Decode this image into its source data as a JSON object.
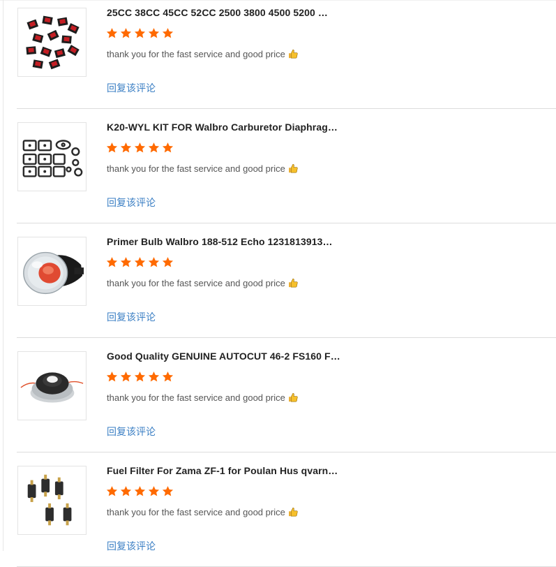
{
  "colors": {
    "star": "#ff6a00",
    "link": "#3b7fc4",
    "title": "#222222",
    "review": "#555555"
  },
  "reviews": [
    {
      "thumb_icon": "rocker-switches-image",
      "title": "25CC 38CC 45CC 52CC 2500 3800 4500 5200 …",
      "rating": 5,
      "text": "thank you for the fast service and good price",
      "reply_label": "回复该评论"
    },
    {
      "thumb_icon": "gasket-kit-image",
      "title": "K20-WYL KIT FOR Walbro Carburetor Diaphrag…",
      "rating": 5,
      "text": "thank you for the fast service and good price",
      "reply_label": "回复该评论"
    },
    {
      "thumb_icon": "primer-bulb-image",
      "title": "Primer Bulb Walbro 188-512 Echo 1231813913…",
      "rating": 5,
      "text": "thank you for the fast service and good price",
      "reply_label": "回复该评论"
    },
    {
      "thumb_icon": "trimmer-head-image",
      "title": "Good Quality GENUINE AUTOCUT 46-2 FS160 F…",
      "rating": 5,
      "text": "thank you for the fast service and good price",
      "reply_label": "回复该评论"
    },
    {
      "thumb_icon": "fuel-filter-image",
      "title": "Fuel Filter For Zama ZF-1 for Poulan Hus qvarn…",
      "rating": 5,
      "text": "thank you for the fast service and good price",
      "reply_label": "回复该评论"
    }
  ]
}
